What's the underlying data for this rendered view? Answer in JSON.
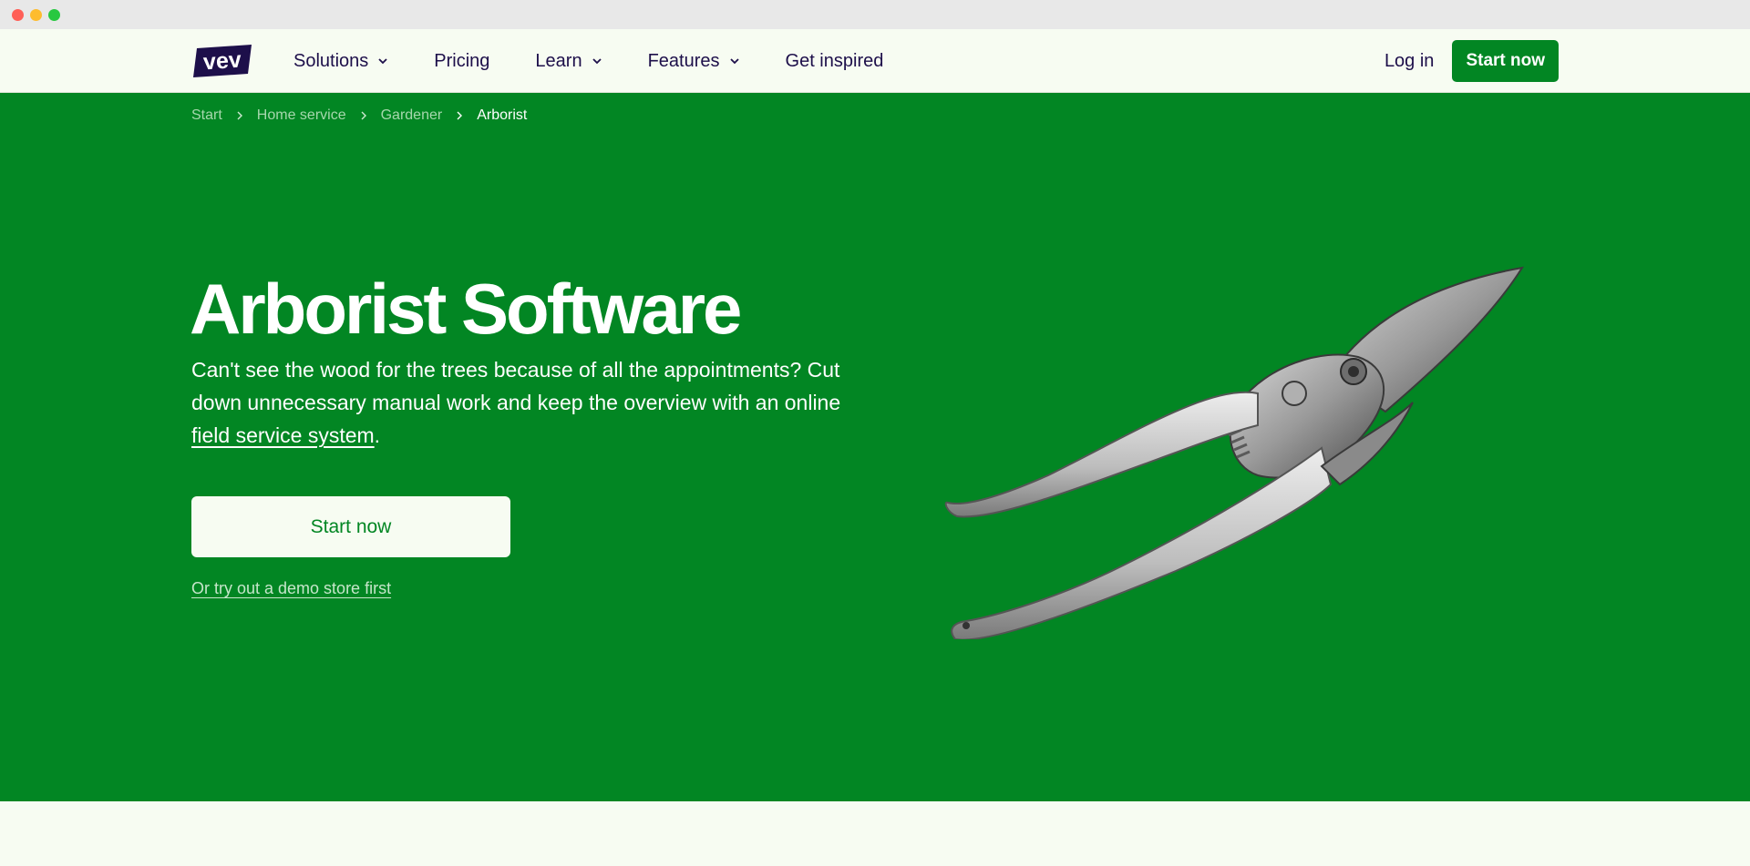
{
  "nav": {
    "logo_text": "vev",
    "items": [
      {
        "label": "Solutions",
        "has_dropdown": true
      },
      {
        "label": "Pricing",
        "has_dropdown": false
      },
      {
        "label": "Learn",
        "has_dropdown": true
      },
      {
        "label": "Features",
        "has_dropdown": true
      },
      {
        "label": "Get inspired",
        "has_dropdown": false
      }
    ],
    "login_label": "Log in",
    "cta_label": "Start now"
  },
  "breadcrumb": [
    "Start",
    "Home service",
    "Gardener",
    "Arborist"
  ],
  "hero": {
    "title": "Arborist Software",
    "desc_before": "Can't see the wood for the trees because of all the appointments? Cut down unnecessary manual work and keep the overview with an online ",
    "desc_link": "field service system",
    "desc_after": ".",
    "cta_label": "Start now",
    "demo_link": "Or try out a demo store first",
    "image_icon": "pruning-shears"
  },
  "colors": {
    "brand_green": "#028623",
    "brand_purple": "#1d0f4a",
    "background": "#f7fcf2"
  }
}
